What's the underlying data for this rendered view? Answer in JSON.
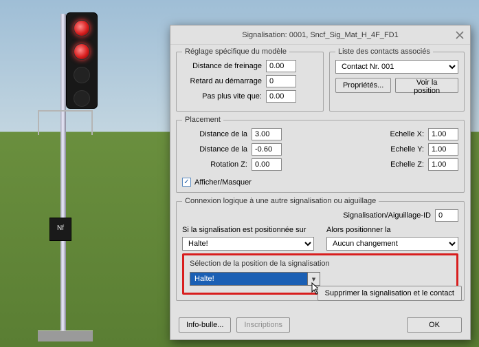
{
  "dialog_title": "Signalisation: 0001, Sncf_Sig_Mat_H_4F_FD1",
  "model": {
    "legend": "Réglage spécifique du modèle",
    "brake_label": "Distance de freinage",
    "brake_value": "0.00",
    "delay_label": "Retard au démarrage",
    "delay_value": "0",
    "maxspeed_label": "Pas plus vite que:",
    "maxspeed_value": "0.00"
  },
  "contacts": {
    "legend": "Liste des contacts associés",
    "selected": "Contact Nr. 001",
    "props_btn": "Propriétés...",
    "pos_btn": "Voir la position"
  },
  "placement": {
    "legend": "Placement",
    "dist1_label": "Distance de la",
    "dist1_value": "3.00",
    "dist2_label": "Distance de la",
    "dist2_value": "-0.60",
    "rotz_label": "Rotation Z:",
    "rotz_value": "0.00",
    "sx_label": "Echelle X:",
    "sx_value": "1.00",
    "sy_label": "Echelle Y:",
    "sy_value": "1.00",
    "sz_label": "Echelle Z:",
    "sz_value": "1.00",
    "show_hide": "Afficher/Masquer"
  },
  "conn": {
    "legend": "Connexion logique à une autre signalisation ou aiguillage",
    "id_label": "Signalisation/Aiguillage-ID",
    "id_value": "0",
    "if_label": "Si la signalisation est positionnée sur",
    "if_value": "Halte!",
    "then_label": "Alors positionner la",
    "then_value": "Aucun changement"
  },
  "selection": {
    "legend": "Sélection de la position de la signalisation",
    "value": "Halte!"
  },
  "buttons": {
    "delete_contact": "Supprimer la signalisation et le contact",
    "tooltip": "Info-bulle...",
    "inscriptions": "Inscriptions",
    "ok": "OK"
  },
  "signal_plate": "Nf"
}
